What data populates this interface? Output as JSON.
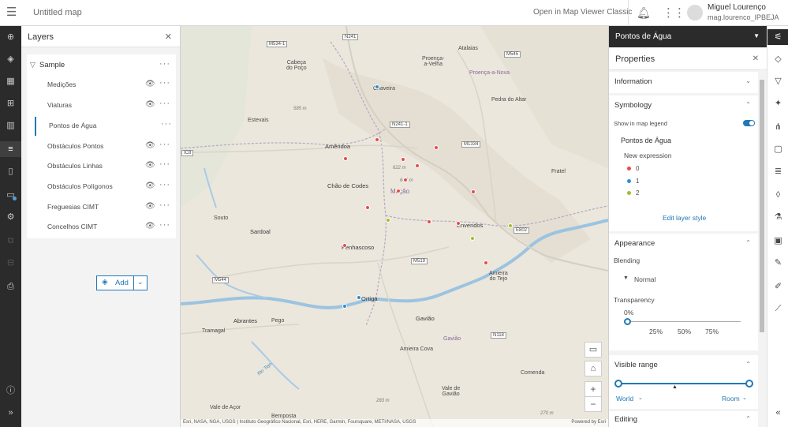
{
  "header": {
    "map_title": "Untitled map",
    "classic_link": "Open in Map Viewer Classic",
    "user_name": "Miguel Lourenço",
    "user_id": "mag.lourenco_IPBEJA"
  },
  "layers_panel": {
    "title": "Layers",
    "group_name": "Sample",
    "layers": [
      {
        "label": "Medições"
      },
      {
        "label": "Viaturas"
      },
      {
        "label": "Pontos de Água"
      },
      {
        "label": "Obstáculos Pontos"
      },
      {
        "label": "Obstáculos Linhas"
      },
      {
        "label": "Obstáculos Polígonos"
      },
      {
        "label": "Freguesias CIMT"
      },
      {
        "label": "Concelhos CIMT"
      }
    ],
    "add_label": "Add"
  },
  "map": {
    "places": [
      {
        "name": "Proença-\na-Velha"
      },
      {
        "name": "Atalaias"
      },
      {
        "name": "Cabeça\ndo Poço"
      },
      {
        "name": "Chaveira"
      },
      {
        "name": "Estevais"
      },
      {
        "name": "Pedra do Altar"
      },
      {
        "name": "Amêndoa"
      },
      {
        "name": "Chão de Codes"
      },
      {
        "name": "Souto"
      },
      {
        "name": "Sardoal"
      },
      {
        "name": "Penhascoso"
      },
      {
        "name": "Envendos"
      },
      {
        "name": "Fratel"
      },
      {
        "name": "Ortiga"
      },
      {
        "name": "Abrantes"
      },
      {
        "name": "Pego"
      },
      {
        "name": "Tramagal"
      },
      {
        "name": "Gavião"
      },
      {
        "name": "Amieira Cova"
      },
      {
        "name": "Amieira\ndo Tejo"
      },
      {
        "name": "Comenda"
      },
      {
        "name": "Vale de\nGavião"
      },
      {
        "name": "Vale de Açor"
      },
      {
        "name": "Bemposta"
      }
    ],
    "districts": [
      "Proença-a-Nova",
      "Mação",
      "Gavião"
    ],
    "elevations": [
      "585 m",
      "622 m",
      "647 m",
      "283 m",
      "270 m"
    ],
    "roads": [
      "N241",
      "M534-1",
      "M545",
      "N241-1",
      "M1334",
      "IC8",
      "E802",
      "M519",
      "M544",
      "N118"
    ],
    "rivers": [
      "Rio Tejo"
    ],
    "attribution": "Esri, NASA, NGA, USGS | Instituto Geográfico Nacional, Esri, HERE, Garmin, Foursquare, METI/NASA, USGS",
    "powered_by": "Powered by Esri"
  },
  "properties_panel": {
    "layer_name": "Pontos de Água",
    "title": "Properties",
    "information": "Information",
    "symbology": "Symbology",
    "show_in_legend": "Show in map legend",
    "legend_title": "Pontos de Água",
    "expression": "New expression",
    "classes": [
      {
        "label": "0",
        "color": "#e84b4b"
      },
      {
        "label": "1",
        "color": "#2b8fd6"
      },
      {
        "label": "2",
        "color": "#9fbf2f"
      }
    ],
    "edit_style": "Edit layer style",
    "appearance": "Appearance",
    "blending": "Blending",
    "blend_mode": "Normal",
    "transparency": "Transparency",
    "transparency_value": "0%",
    "transparency_ticks": [
      "25%",
      "50%",
      "75%"
    ],
    "visible_range": "Visible range",
    "range_min": "World",
    "range_max": "Room",
    "editing": "Editing"
  },
  "colors": {
    "accent": "#2279b5",
    "dark": "#2b2b2b"
  }
}
